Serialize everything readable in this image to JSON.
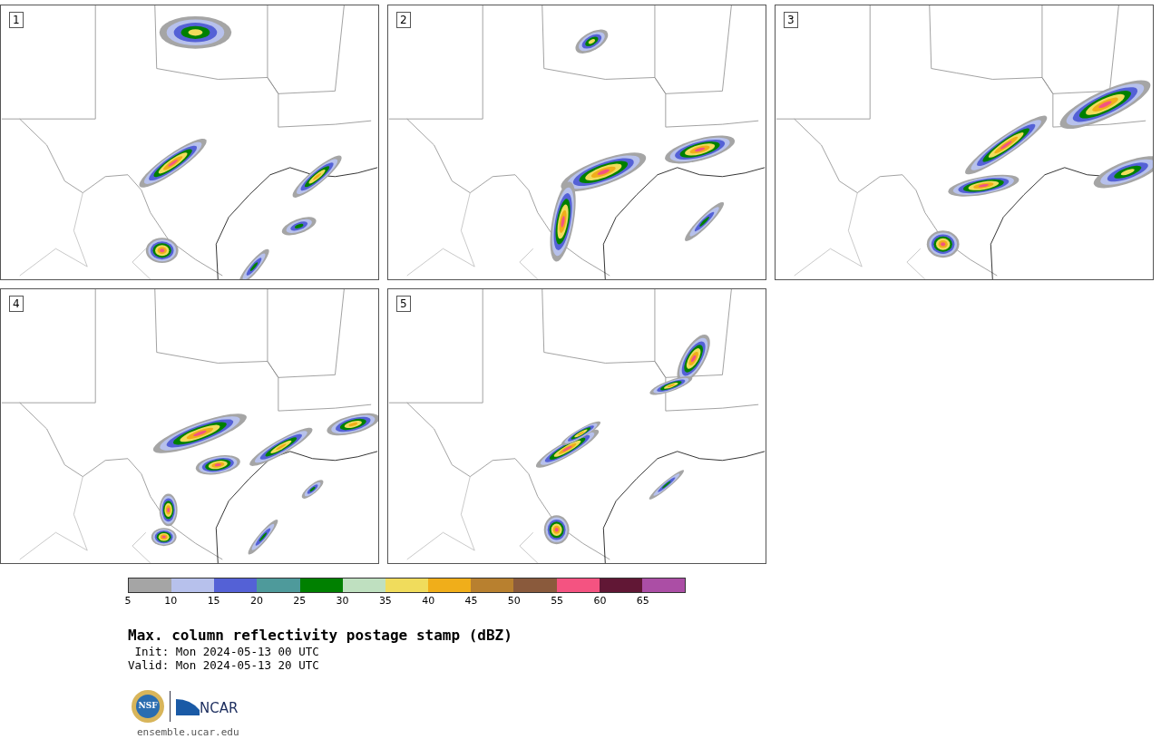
{
  "panels": [
    {
      "label": "1"
    },
    {
      "label": "2"
    },
    {
      "label": "3"
    },
    {
      "label": "4"
    },
    {
      "label": "5"
    }
  ],
  "colorbar": [
    {
      "label": "5",
      "color": "#a5a5a5"
    },
    {
      "label": "10",
      "color": "#b7c1ec"
    },
    {
      "label": "15",
      "color": "#5461d6"
    },
    {
      "label": "20",
      "color": "#4e9a9b"
    },
    {
      "label": "25",
      "color": "#008000"
    },
    {
      "label": "30",
      "color": "#bfe0c0"
    },
    {
      "label": "35",
      "color": "#f0dc5c"
    },
    {
      "label": "40",
      "color": "#f0ae1a"
    },
    {
      "label": "45",
      "color": "#b8802f"
    },
    {
      "label": "50",
      "color": "#8a5a3c"
    },
    {
      "label": "55",
      "color": "#f45381"
    },
    {
      "label": "60",
      "color": "#611735"
    },
    {
      "label": "65",
      "color": "#ab4ea5"
    }
  ],
  "title": "Max. column reflectivity postage stamp (dBZ)",
  "init": " Init: Mon 2024-05-13 00 UTC",
  "valid": "Valid: Mon 2024-05-13 20 UTC",
  "logos": [
    "NSF",
    "NCAR"
  ],
  "url": "ensemble.ucar.edu"
}
